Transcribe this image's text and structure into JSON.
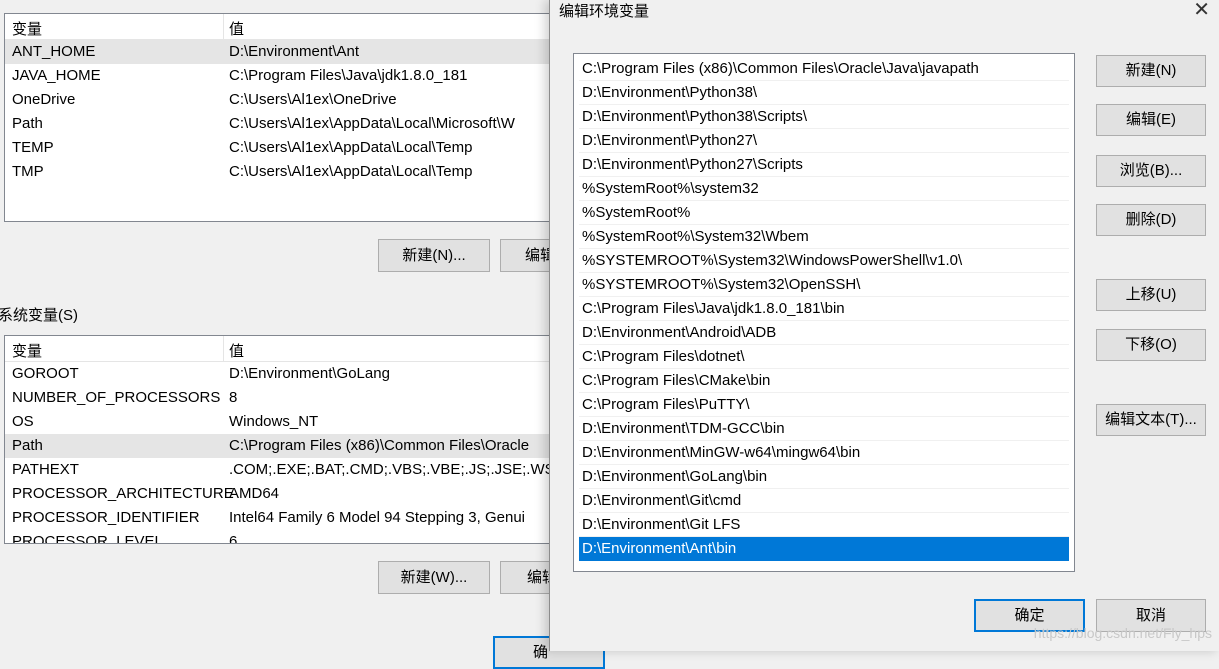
{
  "user_vars": {
    "col_var": "变量",
    "col_val": "值",
    "rows": [
      {
        "name": "ANT_HOME",
        "value": "D:\\Environment\\Ant"
      },
      {
        "name": "JAVA_HOME",
        "value": "C:\\Program Files\\Java\\jdk1.8.0_181"
      },
      {
        "name": "OneDrive",
        "value": "C:\\Users\\Al1ex\\OneDrive"
      },
      {
        "name": "Path",
        "value": "C:\\Users\\Al1ex\\AppData\\Local\\Microsoft\\W"
      },
      {
        "name": "TEMP",
        "value": "C:\\Users\\Al1ex\\AppData\\Local\\Temp"
      },
      {
        "name": "TMP",
        "value": "C:\\Users\\Al1ex\\AppData\\Local\\Temp"
      }
    ],
    "new_btn": "新建(N)...",
    "edit_btn": "编辑"
  },
  "sys_vars": {
    "label": "系统变量(S)",
    "col_var": "变量",
    "col_val": "值",
    "rows": [
      {
        "name": "GOROOT",
        "value": "D:\\Environment\\GoLang"
      },
      {
        "name": "NUMBER_OF_PROCESSORS",
        "value": "8"
      },
      {
        "name": "OS",
        "value": "Windows_NT"
      },
      {
        "name": "Path",
        "value": "C:\\Program Files (x86)\\Common Files\\Oracle"
      },
      {
        "name": "PATHEXT",
        "value": ".COM;.EXE;.BAT;.CMD;.VBS;.VBE;.JS;.JSE;.WSF"
      },
      {
        "name": "PROCESSOR_ARCHITECTURE",
        "value": "AMD64"
      },
      {
        "name": "PROCESSOR_IDENTIFIER",
        "value": "Intel64 Family 6 Model 94 Stepping 3, Genui"
      },
      {
        "name": "PROCESSOR_LEVEL",
        "value": "6"
      }
    ],
    "new_btn": "新建(W)...",
    "edit_btn": "编辑",
    "ok_btn": "确"
  },
  "dialog": {
    "title": "编辑环境变量",
    "close": "✕",
    "paths": [
      "C:\\Program Files (x86)\\Common Files\\Oracle\\Java\\javapath",
      "D:\\Environment\\Python38\\",
      "D:\\Environment\\Python38\\Scripts\\",
      "D:\\Environment\\Python27\\",
      "D:\\Environment\\Python27\\Scripts",
      "%SystemRoot%\\system32",
      "%SystemRoot%",
      "%SystemRoot%\\System32\\Wbem",
      "%SYSTEMROOT%\\System32\\WindowsPowerShell\\v1.0\\",
      "%SYSTEMROOT%\\System32\\OpenSSH\\",
      "C:\\Program Files\\Java\\jdk1.8.0_181\\bin",
      "D:\\Environment\\Android\\ADB",
      "C:\\Program Files\\dotnet\\",
      "C:\\Program Files\\CMake\\bin",
      "C:\\Program Files\\PuTTY\\",
      "D:\\Environment\\TDM-GCC\\bin",
      "D:\\Environment\\MinGW-w64\\mingw64\\bin",
      "D:\\Environment\\GoLang\\bin",
      "D:\\Environment\\Git\\cmd",
      "D:\\Environment\\Git LFS",
      "D:\\Environment\\Ant\\bin"
    ],
    "buttons": {
      "new": "新建(N)",
      "edit": "编辑(E)",
      "browse": "浏览(B)...",
      "delete": "删除(D)",
      "up": "上移(U)",
      "down": "下移(O)",
      "edit_text": "编辑文本(T)...",
      "ok": "确定",
      "cancel": "取消"
    },
    "watermark": "https://blog.csdn.net/Fly_hps"
  }
}
